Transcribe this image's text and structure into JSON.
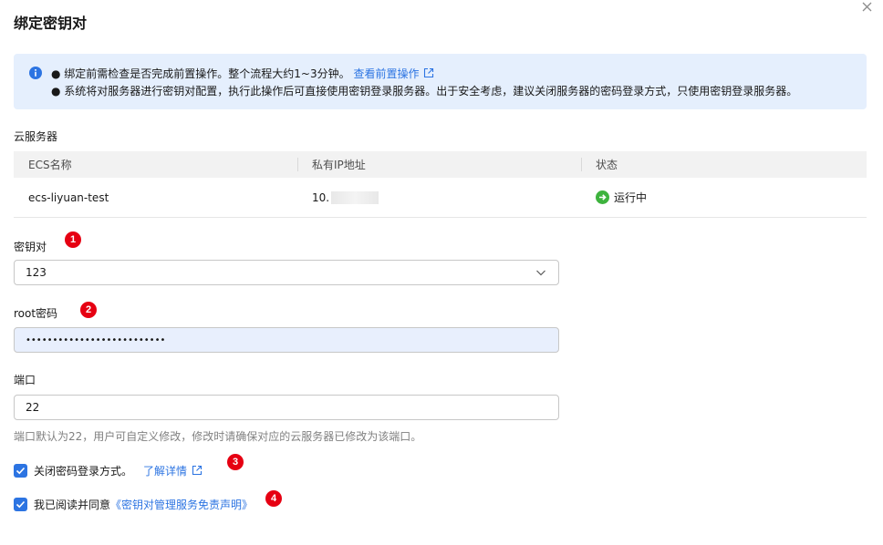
{
  "dialog": {
    "title": "绑定密钥对",
    "close_icon": "close-icon"
  },
  "alert": {
    "line1_text": "● 绑定前需检查是否完成前置操作。整个流程大约1~3分钟。",
    "line1_link": "查看前置操作",
    "line2_text": "● 系统将对服务器进行密钥对配置，执行此操作后可直接使用密钥登录服务器。出于安全考虑，建议关闭服务器的密码登录方式，只使用密钥登录服务器。"
  },
  "servers": {
    "label": "云服务器",
    "columns": [
      "ECS名称",
      "私有IP地址",
      "状态"
    ],
    "rows": [
      {
        "name": "ecs-liyuan-test",
        "ip": "10.",
        "status": "运行中"
      }
    ]
  },
  "keypair": {
    "label": "密钥对",
    "badge": "1",
    "value": "123"
  },
  "root_password": {
    "label": "root密码",
    "badge": "2",
    "masked_value": "••••••••••••••••••••••••••"
  },
  "port": {
    "label": "端口",
    "value": "22",
    "hint": "端口默认为22，用户可自定义修改，修改时请确保对应的云服务器已修改为该端口。"
  },
  "close_password_login": {
    "label": "关闭密码登录方式。",
    "link": "了解详情",
    "badge": "3",
    "checked": true
  },
  "agreement": {
    "prefix": "我已阅读并同意",
    "link": "《密钥对管理服务免责声明》",
    "badge": "4",
    "checked": true
  },
  "colors": {
    "primary": "#2c74e2",
    "alert_bg": "#e5effd",
    "badge": "#e60012",
    "running": "#3eb33e"
  }
}
